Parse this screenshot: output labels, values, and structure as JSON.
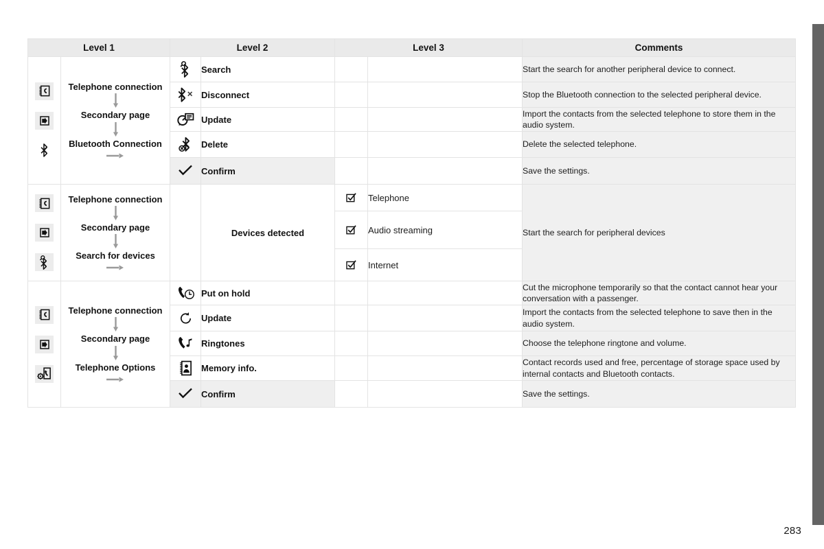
{
  "page": {
    "number": "283"
  },
  "table": {
    "headers": {
      "level1": "Level 1",
      "level2": "Level 2",
      "level3": "Level 3",
      "comments": "Comments"
    },
    "sections": [
      {
        "id": "bluetooth-connection",
        "sidebar_icons": [
          "phonebook-icon",
          "secondary-page-icon",
          "bluetooth-icon"
        ],
        "path": {
          "step1": "Telephone connection",
          "step2": "Secondary page",
          "step3": "Bluetooth Connection"
        },
        "rows": [
          {
            "level2_icon": "bluetooth-search-icon",
            "level2": "Search",
            "level3": "",
            "comment": "Start the search for another peripheral device to connect."
          },
          {
            "level2_icon": "bluetooth-disconnect-icon",
            "level2": "Disconnect",
            "level3": "",
            "comment": "Stop the Bluetooth connection to the selected peripheral device."
          },
          {
            "level2_icon": "contacts-update-icon",
            "level2": "Update",
            "level3": "",
            "comment": "Import the contacts from the selected telephone to store them in the audio system."
          },
          {
            "level2_icon": "bluetooth-delete-icon",
            "level2": "Delete",
            "level3": "",
            "comment": "Delete the selected telephone."
          },
          {
            "level2_icon": "checkmark-icon",
            "level2": "Confirm",
            "level3": "",
            "comment": "Save the settings."
          }
        ]
      },
      {
        "id": "search-for-devices",
        "sidebar_icons": [
          "phonebook-icon",
          "secondary-page-icon",
          "bluetooth-search-icon"
        ],
        "path": {
          "step1": "Telephone connection",
          "step2": "Secondary page",
          "step3": "Search for devices"
        },
        "level2": "Devices detected",
        "comment": "Start the search for peripheral devices",
        "level3_rows": [
          {
            "icon": "checkbox-checked-icon",
            "label": "Telephone"
          },
          {
            "icon": "checkbox-checked-icon",
            "label": "Audio streaming"
          },
          {
            "icon": "checkbox-checked-icon",
            "label": "Internet"
          }
        ]
      },
      {
        "id": "telephone-options",
        "sidebar_icons": [
          "phonebook-icon",
          "secondary-page-icon",
          "telephone-options-icon"
        ],
        "path": {
          "step1": "Telephone connection",
          "step2": "Secondary page",
          "step3": "Telephone Options"
        },
        "rows": [
          {
            "level2_icon": "call-hold-icon",
            "level2": "Put on hold",
            "level3": "",
            "comment": "Cut the microphone temporarily so that the contact cannot hear your conversation with a passenger."
          },
          {
            "level2_icon": "refresh-icon",
            "level2": "Update",
            "level3": "",
            "comment": "Import the contacts from the selected telephone to save then in the audio system."
          },
          {
            "level2_icon": "ringtone-icon",
            "level2": "Ringtones",
            "level3": "",
            "comment": "Choose the telephone ringtone and volume."
          },
          {
            "level2_icon": "memory-info-icon",
            "level2": "Memory info.",
            "level3": "",
            "comment": "Contact records used and free, percentage of storage space used by internal contacts and Bluetooth contacts."
          },
          {
            "level2_icon": "checkmark-icon",
            "level2": "Confirm",
            "level3": "",
            "comment": "Save the settings."
          }
        ]
      }
    ]
  },
  "colors": {
    "header_bg": "#eaeaea",
    "comment_bg": "#f0f0f0",
    "chip_bg": "#ececec",
    "strip": "#646464",
    "grid": "#e3e3e3"
  }
}
